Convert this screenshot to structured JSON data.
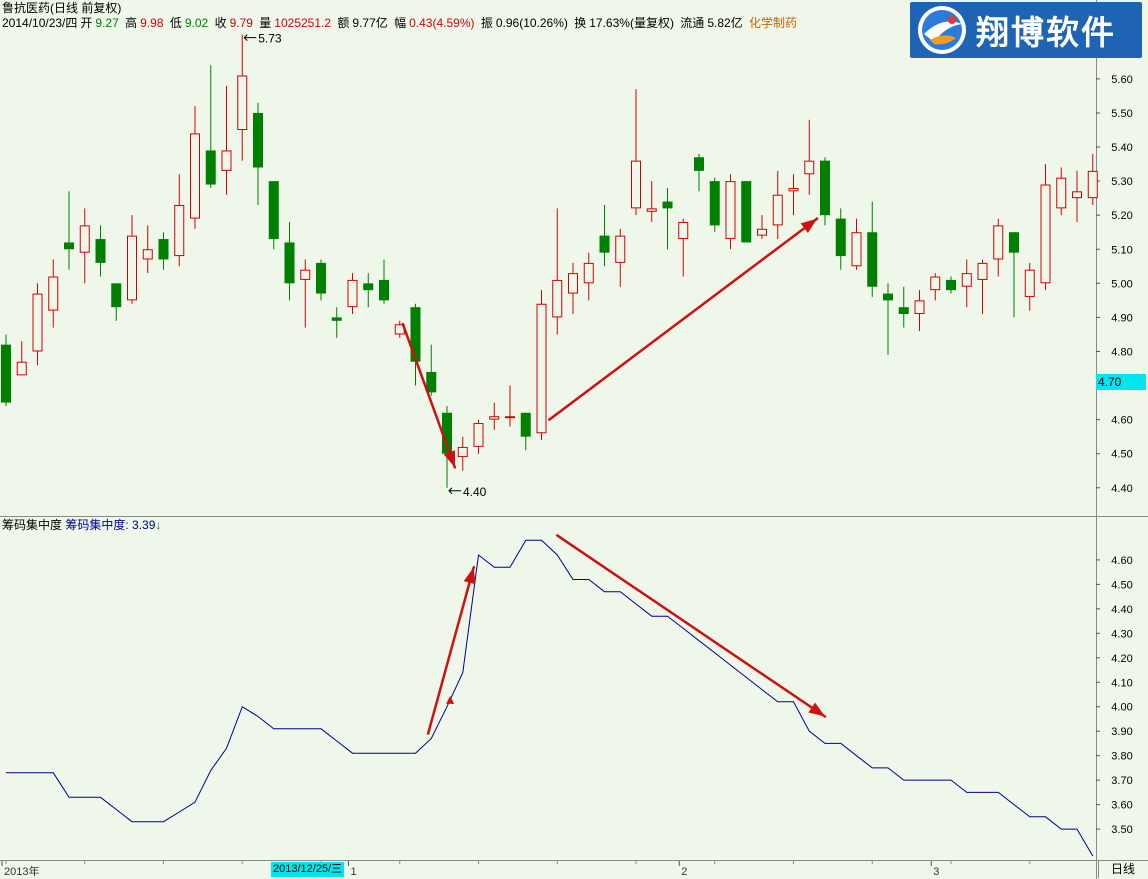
{
  "header": {
    "title": "鲁抗医药(日线 前复权)",
    "date": "2014/10/23/四",
    "open_label": "开",
    "open": "9.27",
    "high_label": "高",
    "high": "9.98",
    "low_label": "低",
    "low": "9.02",
    "close_label": "收",
    "close": "9.79",
    "volume_label": "量",
    "volume": "1025251.2",
    "amount_label": "额",
    "amount": "9.77亿",
    "change_label": "幅",
    "change": "0.43(4.59%)",
    "amplitude_label": "振",
    "amplitude": "0.96(10.26%)",
    "turnover_label": "换",
    "turnover": "17.63%(量复权)",
    "float_label": "流通",
    "float": "5.82亿",
    "sector": "化学制药"
  },
  "logo": {
    "text": "翔博软件"
  },
  "indicator": {
    "name": "筹码集中度",
    "label": "筹码集中度:",
    "value": "3.39",
    "arrow": "↓"
  },
  "price_badge": "4.70",
  "date_badge": "2013/12/25/三",
  "period_button": "日线",
  "colors": {
    "background": "#eef7ea",
    "up": "#d80000",
    "down": "#008000",
    "indicator_line": "#00008b",
    "arrow": "#d01010",
    "highlight": "#00e5ee"
  },
  "chart_data": [
    {
      "type": "candlestick",
      "y_ticks": [
        "4.40",
        "4.50",
        "4.60",
        "4.70",
        "4.80",
        "4.90",
        "5.00",
        "5.10",
        "5.20",
        "5.30",
        "5.40",
        "5.50",
        "5.60"
      ],
      "ylim": [
        4.37,
        5.72
      ],
      "annotations": [
        {
          "text": "5.73",
          "value": 5.73,
          "bar": 15
        },
        {
          "text": "4.40",
          "value": 4.4,
          "bar": 28
        }
      ],
      "candles": [
        {
          "o": 4.82,
          "h": 4.85,
          "l": 4.64,
          "c": 4.65
        },
        {
          "o": 4.73,
          "h": 4.83,
          "l": 4.73,
          "c": 4.77
        },
        {
          "o": 4.8,
          "h": 5.0,
          "l": 4.76,
          "c": 4.97
        },
        {
          "o": 4.92,
          "h": 5.07,
          "l": 4.87,
          "c": 5.02
        },
        {
          "o": 5.12,
          "h": 5.27,
          "l": 5.04,
          "c": 5.1
        },
        {
          "o": 5.09,
          "h": 5.22,
          "l": 5.0,
          "c": 5.17
        },
        {
          "o": 5.13,
          "h": 5.17,
          "l": 5.02,
          "c": 5.06
        },
        {
          "o": 5.0,
          "h": 5.0,
          "l": 4.89,
          "c": 4.93
        },
        {
          "o": 4.95,
          "h": 5.2,
          "l": 4.94,
          "c": 5.14
        },
        {
          "o": 5.07,
          "h": 5.17,
          "l": 5.03,
          "c": 5.1
        },
        {
          "o": 5.13,
          "h": 5.15,
          "l": 5.04,
          "c": 5.07
        },
        {
          "o": 5.08,
          "h": 5.32,
          "l": 5.05,
          "c": 5.23
        },
        {
          "o": 5.19,
          "h": 5.52,
          "l": 5.16,
          "c": 5.44
        },
        {
          "o": 5.39,
          "h": 5.64,
          "l": 5.28,
          "c": 5.29
        },
        {
          "o": 5.33,
          "h": 5.58,
          "l": 5.26,
          "c": 5.39
        },
        {
          "o": 5.45,
          "h": 5.73,
          "l": 5.36,
          "c": 5.61
        },
        {
          "o": 5.5,
          "h": 5.53,
          "l": 5.23,
          "c": 5.34
        },
        {
          "o": 5.3,
          "h": 5.3,
          "l": 5.1,
          "c": 5.13
        },
        {
          "o": 5.12,
          "h": 5.18,
          "l": 4.95,
          "c": 5.0
        },
        {
          "o": 5.01,
          "h": 5.07,
          "l": 4.87,
          "c": 5.04
        },
        {
          "o": 5.06,
          "h": 5.07,
          "l": 4.95,
          "c": 4.97
        },
        {
          "o": 4.9,
          "h": 4.93,
          "l": 4.84,
          "c": 4.89
        },
        {
          "o": 4.93,
          "h": 5.03,
          "l": 4.91,
          "c": 5.01
        },
        {
          "o": 5.0,
          "h": 5.03,
          "l": 4.93,
          "c": 4.98
        },
        {
          "o": 5.01,
          "h": 5.07,
          "l": 4.94,
          "c": 4.95
        },
        {
          "o": 4.85,
          "h": 4.89,
          "l": 4.84,
          "c": 4.88
        },
        {
          "o": 4.93,
          "h": 4.94,
          "l": 4.7,
          "c": 4.77
        },
        {
          "o": 4.74,
          "h": 4.82,
          "l": 4.67,
          "c": 4.68
        },
        {
          "o": 4.62,
          "h": 4.64,
          "l": 4.4,
          "c": 4.5
        },
        {
          "o": 4.49,
          "h": 4.55,
          "l": 4.45,
          "c": 4.52
        },
        {
          "o": 4.52,
          "h": 4.6,
          "l": 4.5,
          "c": 4.59
        },
        {
          "o": 4.6,
          "h": 4.65,
          "l": 4.57,
          "c": 4.61
        },
        {
          "o": 4.61,
          "h": 4.7,
          "l": 4.58,
          "c": 4.61
        },
        {
          "o": 4.62,
          "h": 4.62,
          "l": 4.51,
          "c": 4.55
        },
        {
          "o": 4.56,
          "h": 4.98,
          "l": 4.54,
          "c": 4.94
        },
        {
          "o": 4.9,
          "h": 5.22,
          "l": 4.85,
          "c": 5.01
        },
        {
          "o": 4.97,
          "h": 5.06,
          "l": 4.91,
          "c": 5.03
        },
        {
          "o": 5.0,
          "h": 5.09,
          "l": 4.95,
          "c": 5.06
        },
        {
          "o": 5.14,
          "h": 5.23,
          "l": 5.05,
          "c": 5.09
        },
        {
          "o": 5.06,
          "h": 5.16,
          "l": 4.99,
          "c": 5.14
        },
        {
          "o": 5.22,
          "h": 5.57,
          "l": 5.2,
          "c": 5.36
        },
        {
          "o": 5.21,
          "h": 5.3,
          "l": 5.18,
          "c": 5.22
        },
        {
          "o": 5.24,
          "h": 5.28,
          "l": 5.1,
          "c": 5.22
        },
        {
          "o": 5.13,
          "h": 5.19,
          "l": 5.02,
          "c": 5.18
        },
        {
          "o": 5.37,
          "h": 5.38,
          "l": 5.27,
          "c": 5.33
        },
        {
          "o": 5.3,
          "h": 5.31,
          "l": 5.15,
          "c": 5.17
        },
        {
          "o": 5.13,
          "h": 5.32,
          "l": 5.1,
          "c": 5.3
        },
        {
          "o": 5.3,
          "h": 5.3,
          "l": 5.12,
          "c": 5.12
        },
        {
          "o": 5.14,
          "h": 5.2,
          "l": 5.13,
          "c": 5.16
        },
        {
          "o": 5.17,
          "h": 5.33,
          "l": 5.13,
          "c": 5.26
        },
        {
          "o": 5.27,
          "h": 5.32,
          "l": 5.2,
          "c": 5.28
        },
        {
          "o": 5.32,
          "h": 5.48,
          "l": 5.26,
          "c": 5.36
        },
        {
          "o": 5.36,
          "h": 5.37,
          "l": 5.17,
          "c": 5.2
        },
        {
          "o": 5.19,
          "h": 5.22,
          "l": 5.04,
          "c": 5.08
        },
        {
          "o": 5.05,
          "h": 5.19,
          "l": 5.04,
          "c": 5.15
        },
        {
          "o": 5.15,
          "h": 5.24,
          "l": 4.96,
          "c": 4.99
        },
        {
          "o": 4.97,
          "h": 5.0,
          "l": 4.79,
          "c": 4.95
        },
        {
          "o": 4.93,
          "h": 4.99,
          "l": 4.87,
          "c": 4.91
        },
        {
          "o": 4.91,
          "h": 4.98,
          "l": 4.86,
          "c": 4.95
        },
        {
          "o": 4.98,
          "h": 5.03,
          "l": 4.95,
          "c": 5.02
        },
        {
          "o": 5.01,
          "h": 5.02,
          "l": 4.97,
          "c": 4.98
        },
        {
          "o": 4.99,
          "h": 5.07,
          "l": 4.93,
          "c": 5.03
        },
        {
          "o": 5.01,
          "h": 5.07,
          "l": 4.91,
          "c": 5.06
        },
        {
          "o": 5.07,
          "h": 5.19,
          "l": 5.02,
          "c": 5.17
        },
        {
          "o": 5.15,
          "h": 5.15,
          "l": 4.9,
          "c": 5.09
        },
        {
          "o": 4.96,
          "h": 5.06,
          "l": 4.92,
          "c": 5.04
        },
        {
          "o": 5.0,
          "h": 5.35,
          "l": 4.98,
          "c": 5.29
        },
        {
          "o": 5.22,
          "h": 5.34,
          "l": 5.2,
          "c": 5.31
        },
        {
          "o": 5.25,
          "h": 5.33,
          "l": 5.18,
          "c": 5.27
        },
        {
          "o": 5.25,
          "h": 5.38,
          "l": 5.23,
          "c": 5.33
        }
      ],
      "arrows": [
        {
          "from_bar": 25.2,
          "from": 4.88,
          "to_bar": 28.5,
          "to": 4.46
        },
        {
          "from_bar": 34.5,
          "from": 4.6,
          "to_bar": 51.5,
          "to": 5.19
        }
      ]
    },
    {
      "type": "line",
      "name": "筹码集中度",
      "y_ticks": [
        "3.50",
        "3.60",
        "3.70",
        "3.80",
        "3.90",
        "4.00",
        "4.10",
        "4.20",
        "4.30",
        "4.40",
        "4.50",
        "4.60"
      ],
      "ylim": [
        3.39,
        4.71
      ],
      "values": [
        3.73,
        3.73,
        3.73,
        3.73,
        3.63,
        3.63,
        3.63,
        3.58,
        3.53,
        3.53,
        3.53,
        3.57,
        3.61,
        3.74,
        3.83,
        4.0,
        3.96,
        3.91,
        3.91,
        3.91,
        3.91,
        3.86,
        3.81,
        3.81,
        3.81,
        3.81,
        3.81,
        3.87,
        4.0,
        4.14,
        4.62,
        4.57,
        4.57,
        4.68,
        4.68,
        4.62,
        4.52,
        4.52,
        4.47,
        4.47,
        4.42,
        4.37,
        4.37,
        4.32,
        4.27,
        4.22,
        4.17,
        4.12,
        4.07,
        4.02,
        4.02,
        3.9,
        3.85,
        3.85,
        3.8,
        3.75,
        3.75,
        3.7,
        3.7,
        3.7,
        3.7,
        3.65,
        3.65,
        3.65,
        3.6,
        3.55,
        3.55,
        3.5,
        3.5,
        3.39
      ],
      "arrows": [
        {
          "from_bar": 26.8,
          "from": 3.89,
          "to_bar": 29.7,
          "to": 4.57
        },
        {
          "from_bar": 35.0,
          "from": 4.7,
          "to_bar": 52.0,
          "to": 3.96
        }
      ]
    }
  ],
  "time_axis": {
    "labels": [
      {
        "text": "2013年",
        "bar": 0
      },
      {
        "text": "1",
        "bar": 22
      },
      {
        "text": "2",
        "bar": 43
      },
      {
        "text": "3",
        "bar": 59
      }
    ]
  }
}
